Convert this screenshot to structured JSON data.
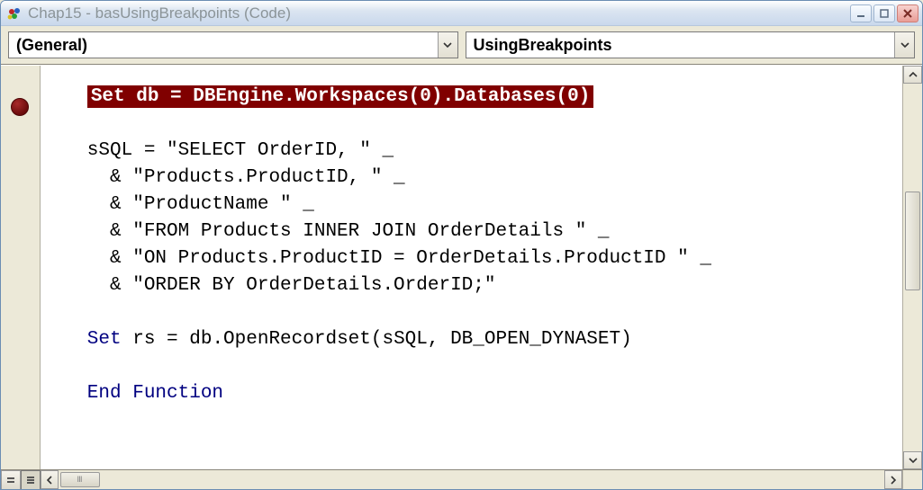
{
  "window": {
    "title": "Chap15 - basUsingBreakpoints (Code)"
  },
  "dropdowns": {
    "left": "(General)",
    "right": "UsingBreakpoints"
  },
  "code": {
    "highlight_prefix": "   ",
    "highlight_text": "Set db = DBEngine.Workspaces(0).Databases(0)",
    "lines": {
      "l1": "   sSQL = \"SELECT OrderID, \" _",
      "l2": "     & \"Products.ProductID, \" _",
      "l3": "     & \"ProductName \" _",
      "l4": "     & \"FROM Products INNER JOIN OrderDetails \" _",
      "l5": "     & \"ON Products.ProductID = OrderDetails.ProductID \" _",
      "l6": "     & \"ORDER BY OrderDetails.OrderID;\""
    },
    "set_kw": "   Set",
    "set_rest": " rs = db.OpenRecordset(sSQL, DB_OPEN_DYNASET)",
    "end_fn": "   End Function"
  },
  "icons": {
    "app": "app-icon",
    "minimize": "minimize-icon",
    "maximize": "maximize-icon",
    "close": "close-icon",
    "chevron_down": "chevron-down-icon",
    "chevron_up": "chevron-up-icon",
    "chevron_left": "chevron-left-icon",
    "chevron_right": "chevron-right-icon"
  }
}
